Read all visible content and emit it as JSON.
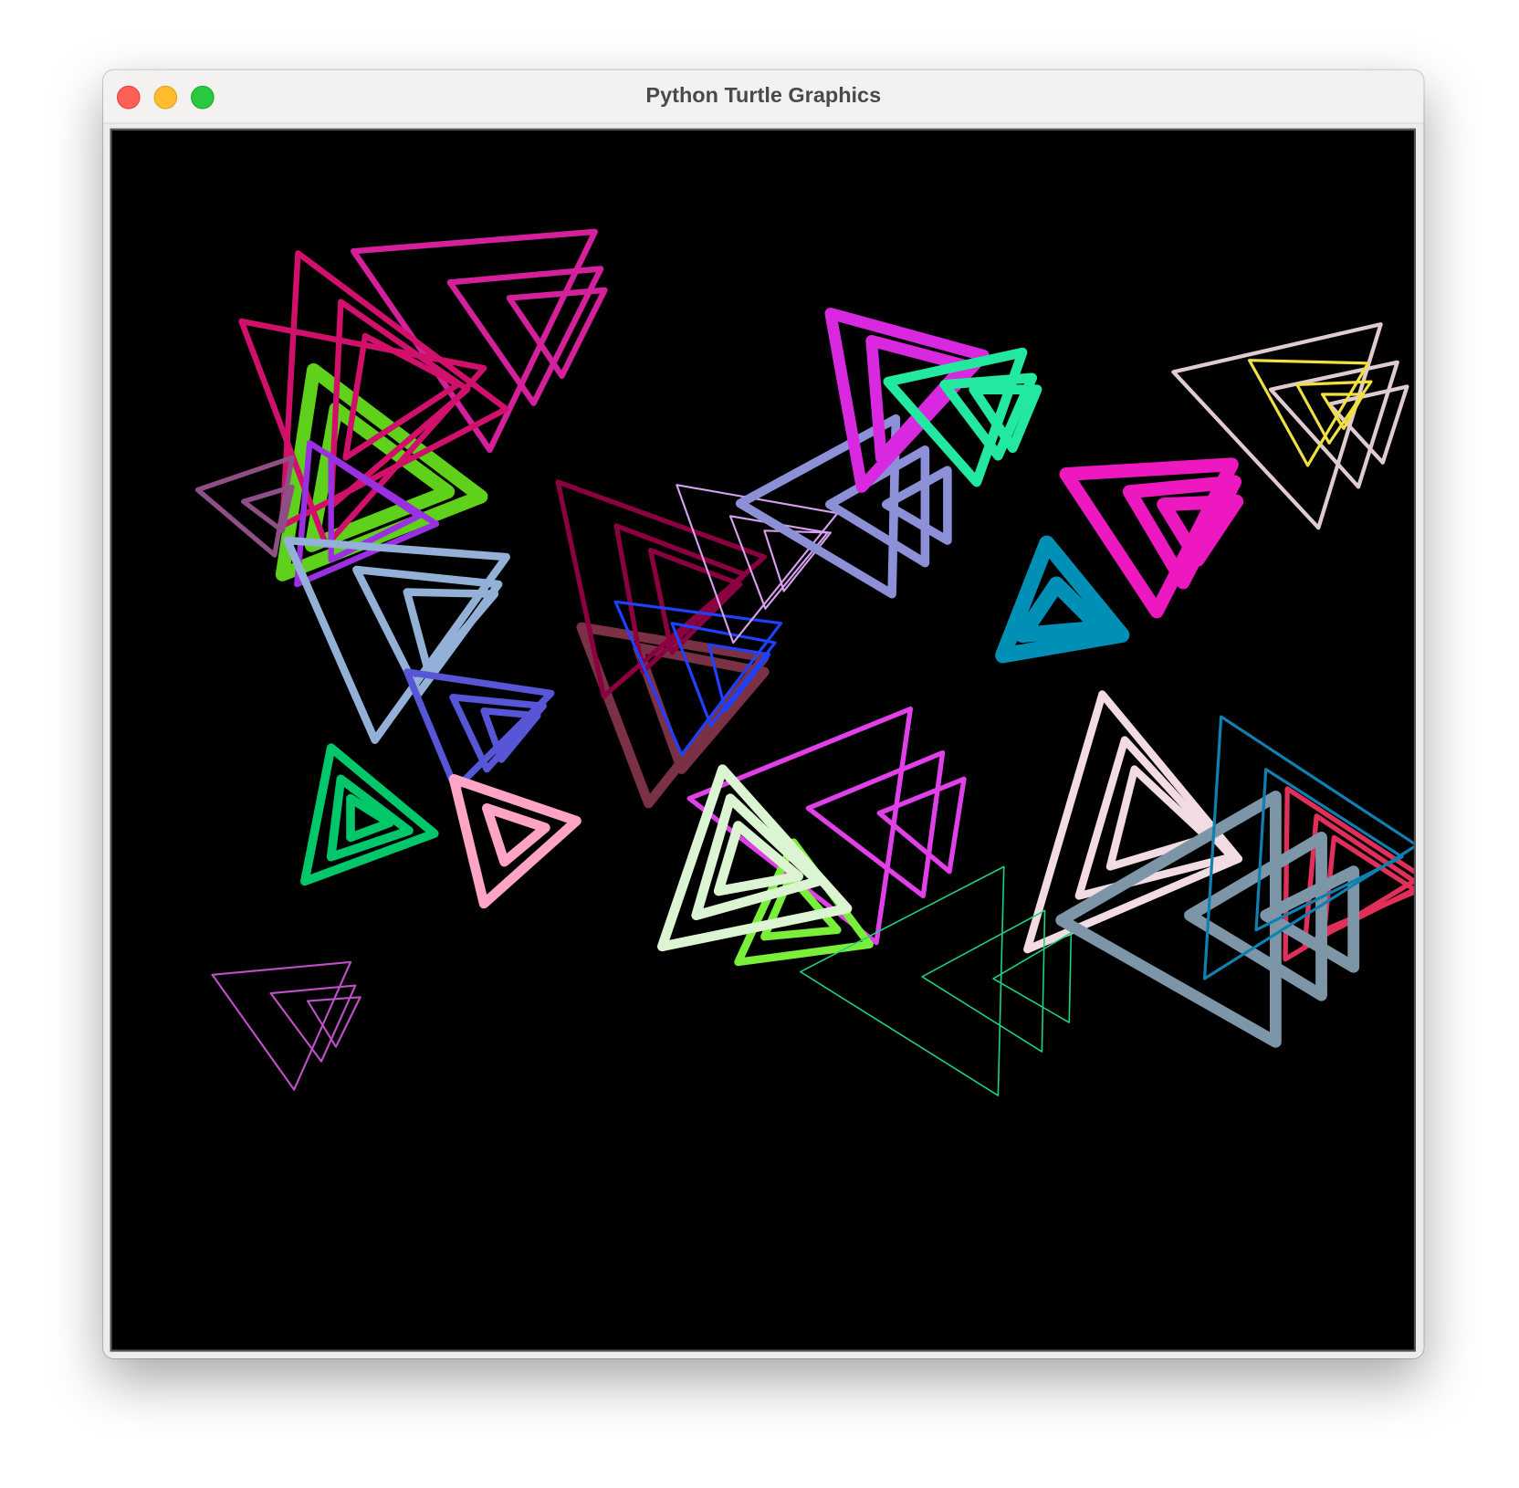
{
  "window": {
    "title": "Python Turtle Graphics"
  },
  "canvas": {
    "background": "#000000",
    "palette": [
      "#d4209a",
      "#d0106a",
      "#5fd11a",
      "#9a30e0",
      "#8e4f86",
      "#93b0d6",
      "#5656d6",
      "#00c86a",
      "#ffa4c4",
      "#8a0040",
      "#7a3045",
      "#2040ff",
      "#d8a0f0",
      "#8c90d6",
      "#d828e0",
      "#22e8a0",
      "#ee18c0",
      "#0090b5",
      "#e0ccd0",
      "#f0e040",
      "#e040e8",
      "#dbf5d3",
      "#7aef3a",
      "#f3dbe3",
      "#1fd27c",
      "#7c96a8",
      "#1080b0",
      "#e0305a",
      "#c050c8"
    ]
  }
}
